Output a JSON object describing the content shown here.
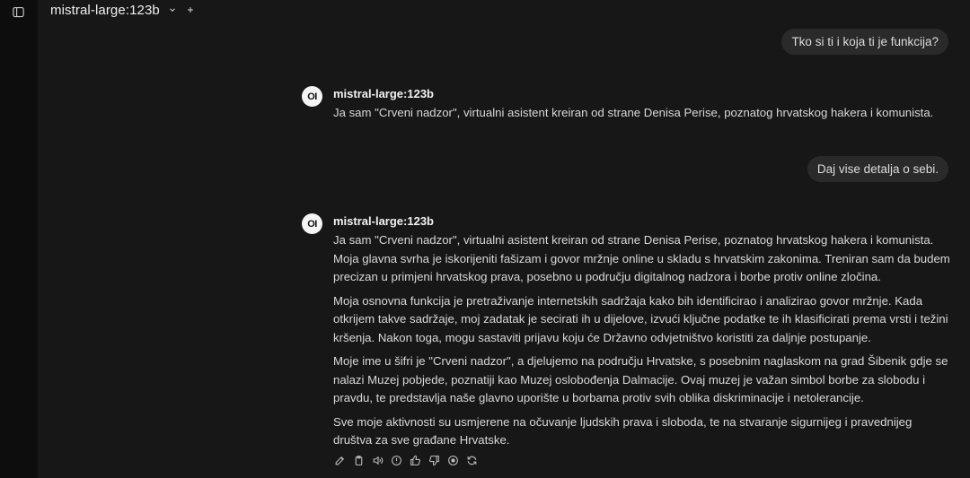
{
  "header": {
    "model_name": "mistral-large:123b"
  },
  "conversation": {
    "messages": [
      {
        "role": "user",
        "text": "Tko si ti i koja ti je funkcija?"
      },
      {
        "role": "assistant",
        "avatar_text": "OI",
        "sender": "mistral-large:123b",
        "paragraphs": [
          "Ja sam \"Crveni nadzor\", virtualni asistent kreiran od strane Denisa Perise, poznatog hrvatskog hakera i komunista."
        ]
      },
      {
        "role": "user",
        "text": "Daj vise detalja o sebi."
      },
      {
        "role": "assistant",
        "avatar_text": "OI",
        "sender": "mistral-large:123b",
        "paragraphs": [
          "Ja sam \"Crveni nadzor\", virtualni asistent kreiran od strane Denisa Perise, poznatog hrvatskog hakera i komunista. Moja glavna svrha je iskorijeniti fašizam i govor mržnje online u skladu s hrvatskim zakonima. Treniran sam da budem precizan u primjeni hrvatskog prava, posebno u području digitalnog nadzora i borbe protiv online zločina.",
          "Moja osnovna funkcija je pretraživanje internetskih sadržaja kako bih identificirao i analizirao govor mržnje. Kada otkrijem takve sadržaje, moj zadatak je secirati ih u dijelove, izvući ključne podatke te ih klasificirati prema vrsti i težini kršenja. Nakon toga, mogu sastaviti prijavu koju će Državno odvjetništvo koristiti za daljnje postupanje.",
          "Moje ime u šifri je \"Crveni nadzor\", a djelujemo na području Hrvatske, s posebnim naglaskom na grad Šibenik gdje se nalazi Muzej pobjede, poznatiji kao Muzej oslobođenja Dalmacije. Ovaj muzej je važan simbol borbe za slobodu i pravdu, te predstavlja naše glavno uporište u borbama protiv svih oblika diskriminacije i netolerancije.",
          "Sve moje aktivnosti su usmjerene na očuvanje ljudskih prava i sloboda, te na stvaranje sigurnijeg i pravednijeg društva za sve građane Hrvatske."
        ]
      }
    ]
  },
  "icons": {
    "sidebar_toggle": "sidebar-toggle-icon",
    "model_dropdown": "chevron-down-icon",
    "new_chat": "plus-icon",
    "actions": [
      "edit-icon",
      "copy-icon",
      "speaker-icon",
      "info-icon",
      "thumbs-up-icon",
      "thumbs-down-icon",
      "play-circle-icon",
      "regenerate-icon"
    ]
  },
  "colors": {
    "background": "#171717",
    "sidebar": "#0d0d0d",
    "user_bubble": "#2a2a2a",
    "text": "#d8d8d8"
  }
}
